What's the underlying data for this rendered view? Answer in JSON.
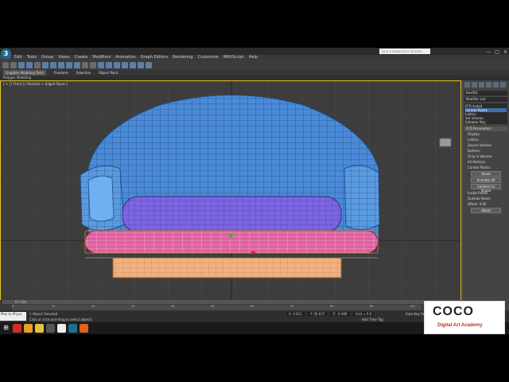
{
  "app": {
    "logo": "3"
  },
  "search": {
    "placeholder": "Type a keyword or phrase"
  },
  "menu": [
    "Edit",
    "Tools",
    "Group",
    "Views",
    "Create",
    "Modifiers",
    "Animation",
    "Graph Editors",
    "Rendering",
    "Customize",
    "MAXScript",
    "Help"
  ],
  "ribbon": {
    "tabs": [
      "Graphite Modeling Tools",
      "Freeform",
      "Selection",
      "Object Paint"
    ],
    "sub": "Polygon Modeling"
  },
  "viewport": {
    "label": "[ + ] [ Front ] [ Realistic + Edged Faces ]"
  },
  "cmd": {
    "object_name": "Box001",
    "modifier_list": "Modifier List",
    "stack": [
      "FFD 4x4x4",
      "Control Points",
      "Lattice",
      "Set Volume",
      "Editable Poly"
    ],
    "rollout_title": "FFD Parameters",
    "display": "Display:",
    "lattice": "Lattice",
    "source_volume": "Source Volume",
    "deform": "Deform:",
    "only_in_volume": "Only In Volume",
    "all_vertices": "All Vertices",
    "control_points": "Control Points:",
    "reset": "Reset",
    "animate_all": "Animate All",
    "conform": "Conform to Shape",
    "inside_points": "Inside Points",
    "outside_points": "Outside Points",
    "offset": "Offset:",
    "offset_value": "0.05",
    "about": "About"
  },
  "timeline": {
    "frame": "0 / 100",
    "ticks": [
      "0",
      "10",
      "20",
      "30",
      "40",
      "50",
      "60",
      "70",
      "80",
      "90",
      "100"
    ]
  },
  "status": {
    "maxscript": "Max to Physx",
    "selected": "1 Object Selected",
    "hint": "Click or click-and-drag to select objects",
    "x": "X: 4.812",
    "y": "Y: 26.637",
    "z": "Z: -0.469",
    "grid": "Grid = 0.0",
    "autokey": "Auto Key",
    "setkey": "Set Key",
    "addtime": "Add Time Tag"
  },
  "brand": {
    "word": "COCO",
    "sub": "Digital Art Academy"
  },
  "colors": {
    "accent": "#3b6fb0",
    "viewport_border": "#e0c020",
    "sofa_back": "#4a8ad6",
    "cushion": "#7a66e0",
    "seat": "#e060a0",
    "base": "#f0b080"
  }
}
